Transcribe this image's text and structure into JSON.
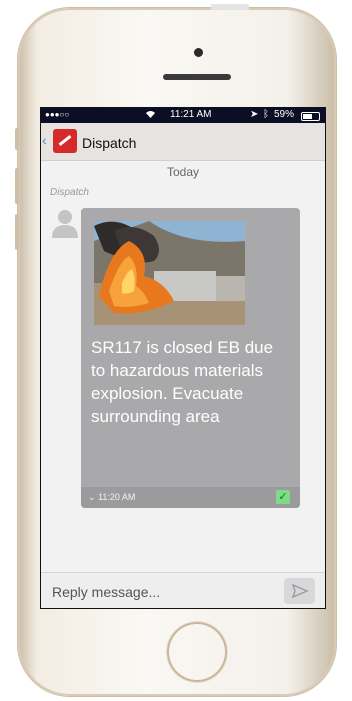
{
  "status_bar": {
    "carrier": "●●●○○",
    "wifi": "wifi-icon",
    "time": "11:21 AM",
    "battery": "59%"
  },
  "header": {
    "back_icon": "back-chevron-icon",
    "logo": "dispatch-logo-icon",
    "title": "Dispatch"
  },
  "conversation": {
    "date_label": "Today",
    "sender_label": "Dispatch",
    "message": {
      "image": "photo of truck fire on highway",
      "text": "SR117 is closed EB due to hazardous materials explosion. Evacuate surrounding area",
      "time": "11:20 AM",
      "status": "delivered-check-icon"
    }
  },
  "reply": {
    "placeholder": "Reply message...",
    "send_icon": "send-icon"
  },
  "colors": {
    "accent": "#4a89c7",
    "logo_red": "#d62a2a",
    "bubble": "#a9a9ab",
    "check": "#7ddc86",
    "status_bar": "#0b0f26"
  }
}
